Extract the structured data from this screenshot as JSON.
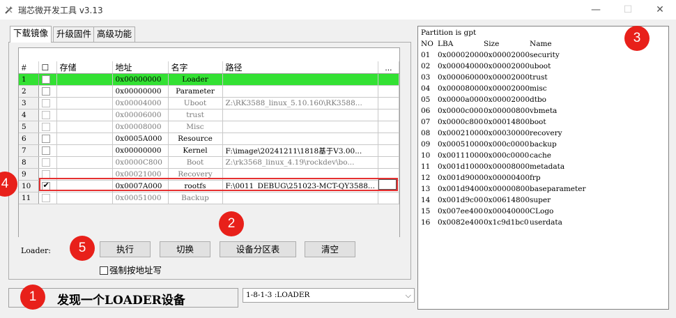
{
  "window": {
    "title": "瑞芯微开发工具 v3.13",
    "minimize": "—",
    "maximize": "☐",
    "close": "✕"
  },
  "tabs": [
    "下载镜像",
    "升级固件",
    "高级功能"
  ],
  "grid": {
    "columns": [
      "#",
      "☐",
      "存储",
      "地址",
      "名字",
      "路径",
      "..."
    ],
    "rows": [
      {
        "num": "1",
        "checked": false,
        "storage": "",
        "address": "0x00000000",
        "name": "Loader",
        "path": "",
        "state": "highlight"
      },
      {
        "num": "2",
        "checked": false,
        "storage": "",
        "address": "0x00000000",
        "name": "Parameter",
        "path": "",
        "state": "normal"
      },
      {
        "num": "3",
        "checked": false,
        "storage": "",
        "address": "0x00004000",
        "name": "Uboot",
        "path": "Z:\\RK3588_linux_5.10.160\\RK3588...",
        "state": "dim"
      },
      {
        "num": "4",
        "checked": false,
        "storage": "",
        "address": "0x00006000",
        "name": "trust",
        "path": "",
        "state": "dim"
      },
      {
        "num": "5",
        "checked": false,
        "storage": "",
        "address": "0x00008000",
        "name": "Misc",
        "path": "",
        "state": "dim"
      },
      {
        "num": "6",
        "checked": false,
        "storage": "",
        "address": "0x0005A000",
        "name": "Resource",
        "path": "",
        "state": "normal"
      },
      {
        "num": "7",
        "checked": false,
        "storage": "",
        "address": "0x00000000",
        "name": "Kernel",
        "path": "F:\\image\\20241211\\1818基于V3.00...",
        "state": "normal"
      },
      {
        "num": "8",
        "checked": false,
        "storage": "",
        "address": "0x0000C800",
        "name": "Boot",
        "path": "Z:\\rk3568_linux_4.19\\rockdev\\bo...",
        "state": "dim"
      },
      {
        "num": "9",
        "checked": false,
        "storage": "",
        "address": "0x00021000",
        "name": "Recovery",
        "path": "",
        "state": "dim"
      },
      {
        "num": "10",
        "checked": true,
        "storage": "",
        "address": "0x0007A000",
        "name": "rootfs",
        "path": "F:\\0011_DEBUG\\251023-MCT-QY3588...",
        "state": "normal"
      },
      {
        "num": "11",
        "checked": false,
        "storage": "",
        "address": "0x00051000",
        "name": "Backup",
        "path": "",
        "state": "dim"
      }
    ]
  },
  "buttons": {
    "loader_label": "Loader:",
    "execute": "执行",
    "switch": "切换",
    "partition_table": "设备分区表",
    "clear": "清空",
    "force_write": "强制按地址写"
  },
  "status": {
    "message": "发现一个LOADER设备",
    "device": "1-8-1-3 :LOADER"
  },
  "partition_panel": {
    "title": "Partition is gpt",
    "header": {
      "no": "NO",
      "lba": "LBA",
      "size": "Size",
      "name": "Name"
    },
    "rows": [
      {
        "no": "01",
        "lba": "0x00002000",
        "size": "0x00002000",
        "name": "security"
      },
      {
        "no": "02",
        "lba": "0x00004000",
        "size": "0x00002000",
        "name": "uboot"
      },
      {
        "no": "03",
        "lba": "0x00006000",
        "size": "0x00002000",
        "name": "trust"
      },
      {
        "no": "04",
        "lba": "0x00008000",
        "size": "0x00002000",
        "name": "misc"
      },
      {
        "no": "05",
        "lba": "0x0000a000",
        "size": "0x00002000",
        "name": "dtbo"
      },
      {
        "no": "06",
        "lba": "0x0000c000",
        "size": "0x00000800",
        "name": "vbmeta"
      },
      {
        "no": "07",
        "lba": "0x0000c800",
        "size": "0x00014800",
        "name": "boot"
      },
      {
        "no": "08",
        "lba": "0x00021000",
        "size": "0x00030000",
        "name": "recovery"
      },
      {
        "no": "09",
        "lba": "0x00051000",
        "size": "0x000c0000",
        "name": "backup"
      },
      {
        "no": "10",
        "lba": "0x00111000",
        "size": "0x000c0000",
        "name": "cache"
      },
      {
        "no": "11",
        "lba": "0x001d1000",
        "size": "0x00008000",
        "name": "metadata"
      },
      {
        "no": "12",
        "lba": "0x001d9000",
        "size": "0x00000400",
        "name": "frp"
      },
      {
        "no": "13",
        "lba": "0x001d9400",
        "size": "0x00000800",
        "name": "baseparameter"
      },
      {
        "no": "14",
        "lba": "0x001d9c00",
        "size": "0x00614800",
        "name": "super"
      },
      {
        "no": "15",
        "lba": "0x007ee400",
        "size": "0x00040000",
        "name": "CLogo"
      },
      {
        "no": "16",
        "lba": "0x0082e400",
        "size": "0x1c9d1bc0",
        "name": "userdata"
      }
    ]
  },
  "markers": [
    "1",
    "2",
    "3",
    "4",
    "5"
  ],
  "colors": {
    "highlight": "#33e133",
    "marker": "#e8201a",
    "row_outline": "#e53030"
  }
}
